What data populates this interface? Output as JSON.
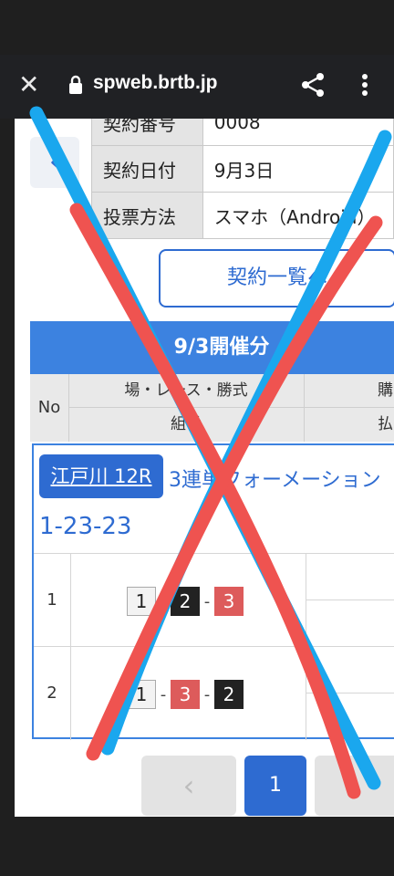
{
  "browser": {
    "url": "spweb.brtb.jp",
    "close_icon": "close-icon",
    "lock_icon": "lock-icon",
    "share_icon": "share-icon",
    "menu_icon": "more-vert-icon"
  },
  "info_table": {
    "rows": [
      {
        "key": "契約番号",
        "value": "0008"
      },
      {
        "key": "契約日付",
        "value": "9月3日"
      },
      {
        "key": "投票方法",
        "value": "スマホ（Android）"
      }
    ]
  },
  "back_icon": "‹",
  "contract_list_button": "契約一覧へ",
  "section": {
    "title": "9/3開催分",
    "headers": {
      "no": "No",
      "place_race_type": "場・レース・勝式",
      "combination": "組番",
      "purchase": "購",
      "payout": "払"
    }
  },
  "bet": {
    "race": "江戸川 12R",
    "type": "3連単フォーメーション",
    "combo": "1-23-23",
    "rows": [
      {
        "no": "1",
        "chips": [
          "1",
          "2",
          "3"
        ]
      },
      {
        "no": "2",
        "chips": [
          "1",
          "3",
          "2"
        ]
      }
    ]
  },
  "pager": {
    "prev": "‹",
    "current": "1"
  },
  "colors": {
    "accent": "#2e6bd1",
    "header": "#3c82e0",
    "overlay_blue": "#1aa7ee",
    "overlay_red": "#ef5350"
  }
}
